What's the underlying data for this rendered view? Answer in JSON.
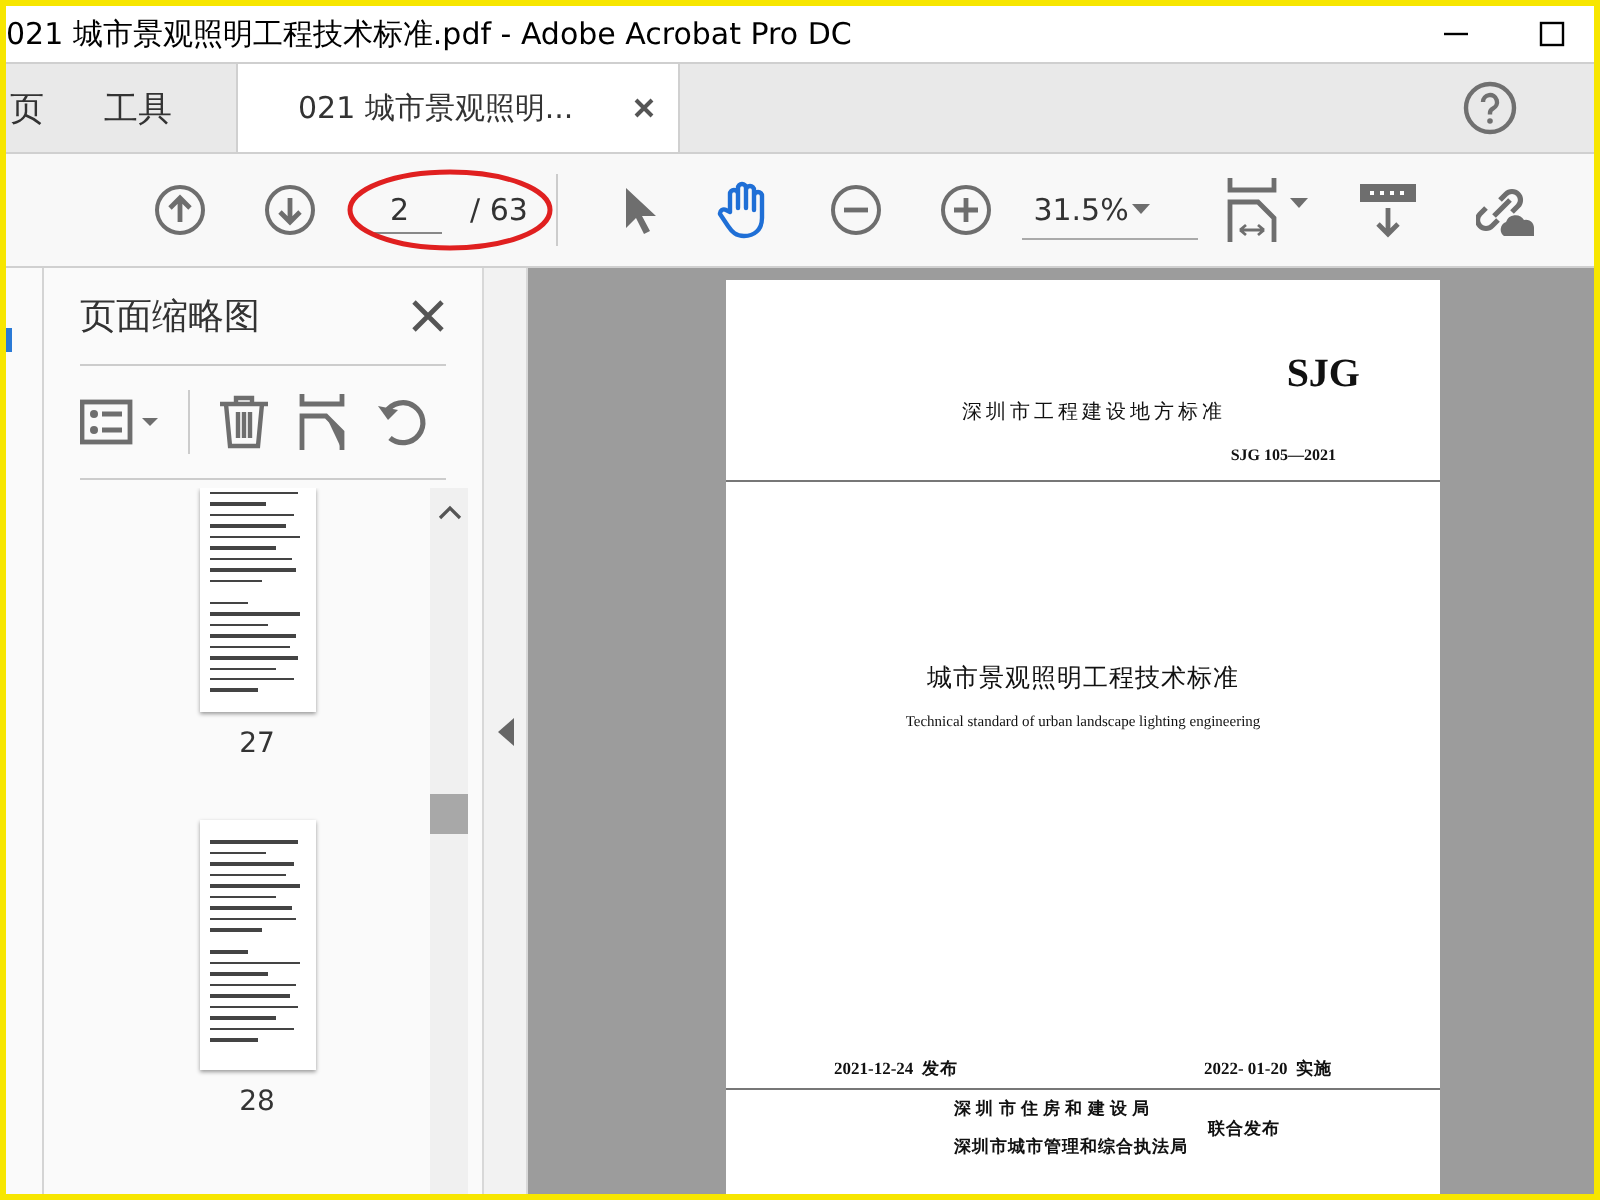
{
  "window": {
    "title": "021 城市景观照明工程技术标准.pdf - Adobe Acrobat Pro DC"
  },
  "tabs": [
    {
      "label": "页",
      "selected": false
    },
    {
      "label": "工具",
      "selected": false
    },
    {
      "label": "021 城市景观照明...",
      "selected": true
    }
  ],
  "toolbar": {
    "page_number": "2",
    "page_count": "/ 63",
    "zoom": "31.5%"
  },
  "sidebar": {
    "title": "页面缩略图",
    "thumbnails": [
      {
        "label": "27"
      },
      {
        "label": "28"
      }
    ]
  },
  "document": {
    "code_mark": "SJG",
    "category": "深圳市工程建设地方标准",
    "standard_number": "SJG 105—2021",
    "title": "城市景观照明工程技术标准",
    "subtitle": "Technical standard of urban landscape lighting engineering",
    "issue_date": "2021-12-24  发布",
    "effective_date": "2022- 01-20  实施",
    "issuers": [
      "深 圳 市 住 房 和 建 设 局",
      "深圳市城市管理和综合执法局"
    ],
    "joint_issue": "联合发布"
  }
}
